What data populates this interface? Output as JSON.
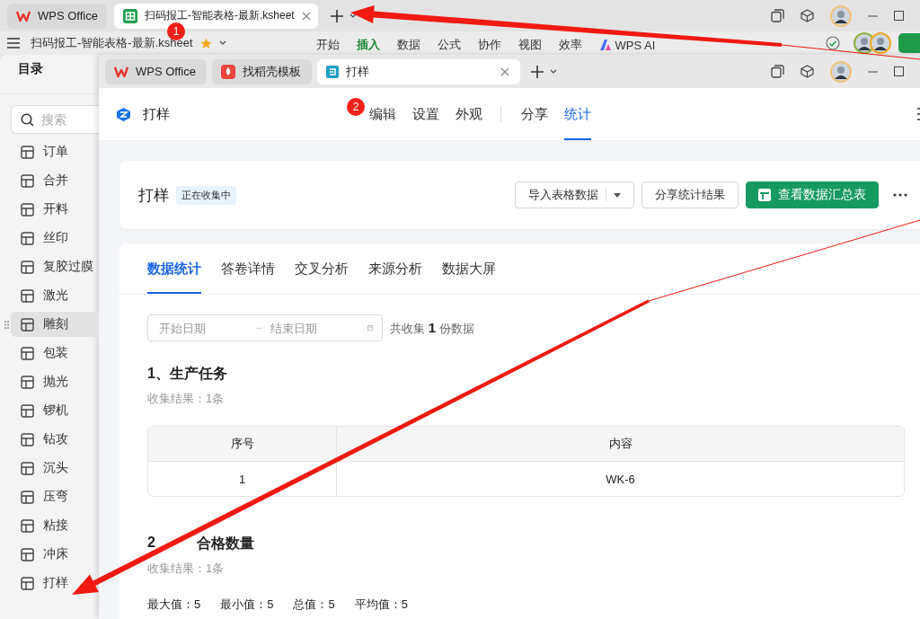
{
  "back_window": {
    "tabs": [
      {
        "label": "WPS Office",
        "kind": "home",
        "selected": false
      },
      {
        "label": "扫码报工-智能表格-最新.ksheet",
        "kind": "sheet",
        "selected": true
      }
    ],
    "doc_title": "扫码报工-智能表格-最新.ksheet",
    "menu": [
      {
        "label": "开始",
        "selected": false
      },
      {
        "label": "插入",
        "selected": true
      },
      {
        "label": "数据",
        "selected": false
      },
      {
        "label": "公式",
        "selected": false
      },
      {
        "label": "协作",
        "selected": false
      },
      {
        "label": "视图",
        "selected": false
      },
      {
        "label": "效率",
        "selected": false
      }
    ],
    "ai_label": "WPS AI"
  },
  "sidebar": {
    "title": "目录",
    "search": {
      "placeholder": "搜索"
    },
    "items": [
      {
        "label": "订单",
        "selected": false
      },
      {
        "label": "合并",
        "selected": false
      },
      {
        "label": "开料",
        "selected": false
      },
      {
        "label": "丝印",
        "selected": false
      },
      {
        "label": "复胶过膜",
        "selected": false
      },
      {
        "label": "激光",
        "selected": false
      },
      {
        "label": "雕刻",
        "selected": true
      },
      {
        "label": "包装",
        "selected": false
      },
      {
        "label": "抛光",
        "selected": false
      },
      {
        "label": "锣机",
        "selected": false
      },
      {
        "label": "钻攻",
        "selected": false
      },
      {
        "label": "沉头",
        "selected": false
      },
      {
        "label": "压弯",
        "selected": false
      },
      {
        "label": "粘接",
        "selected": false
      },
      {
        "label": "冲床",
        "selected": false
      },
      {
        "label": "打样",
        "selected": false
      }
    ]
  },
  "front_window": {
    "tabs": [
      {
        "label": "WPS Office",
        "kind": "home",
        "selected": false
      },
      {
        "label": "找稻壳模板",
        "kind": "template",
        "selected": false
      },
      {
        "label": "打样",
        "kind": "form",
        "selected": true
      }
    ],
    "app_name": "打样",
    "nav": [
      {
        "label": "编辑",
        "selected": false,
        "divider_before": false
      },
      {
        "label": "设置",
        "selected": false,
        "divider_before": false
      },
      {
        "label": "外观",
        "selected": false,
        "divider_before": false
      },
      {
        "label": "分享",
        "selected": false,
        "divider_before": true
      },
      {
        "label": "统计",
        "selected": true,
        "divider_before": false
      }
    ],
    "form_card": {
      "title": "打样",
      "status": "正在收集中",
      "import_button": "导入表格数据",
      "share_button": "分享统计结果",
      "summary_button": "查看数据汇总表"
    },
    "stats": {
      "tabs": [
        {
          "label": "数据统计",
          "selected": true
        },
        {
          "label": "答卷详情",
          "selected": false
        },
        {
          "label": "交叉分析",
          "selected": false
        },
        {
          "label": "来源分析",
          "selected": false
        },
        {
          "label": "数据大屏",
          "selected": false
        }
      ],
      "date_range": {
        "start_placeholder": "开始日期",
        "end_placeholder": "结束日期"
      },
      "total": "共收集 **1** 份数据",
      "questions": [
        {
          "kind": "table",
          "title": "1、生产任务",
          "result": "收集结果：1条",
          "columns": [
            "序号",
            "内容"
          ],
          "rows": [
            [
              "1",
              "WK-6"
            ]
          ]
        },
        {
          "kind": "numbers",
          "number": "2",
          "title": "合格数量",
          "result": "收集结果：1条",
          "values": [
            "最大值：5",
            "最小值：5",
            "总值：5",
            "平均值：5"
          ]
        }
      ]
    }
  },
  "annotations": [
    {
      "label": "1"
    },
    {
      "label": "2"
    }
  ]
}
